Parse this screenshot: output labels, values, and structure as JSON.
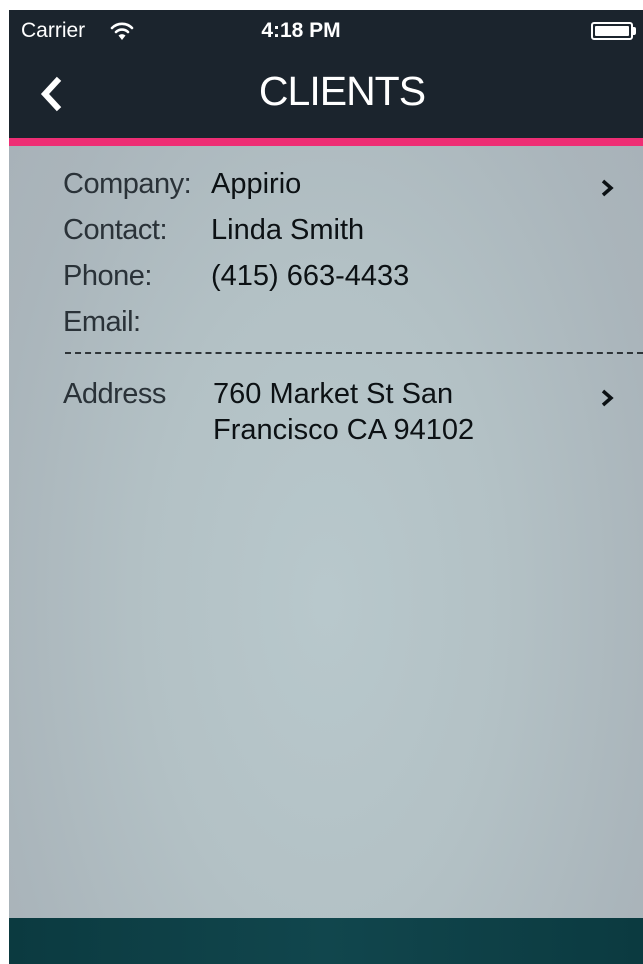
{
  "status_bar": {
    "carrier": "Carrier",
    "time": "4:18 PM",
    "wifi_icon": "wifi-icon",
    "battery_icon": "battery-full-icon"
  },
  "nav": {
    "title": "CLIENTS",
    "back_icon": "chevron-left-icon"
  },
  "colors": {
    "topbar": "#1b242d",
    "accent": "#ee2e74",
    "bottombar": "#0b3a40"
  },
  "fields": {
    "company": {
      "label": "Company:",
      "value": "Appirio"
    },
    "contact": {
      "label": "Contact:",
      "value": "Linda Smith"
    },
    "phone": {
      "label": "Phone:",
      "value": "(415) 663-4433"
    },
    "email": {
      "label": "Email:",
      "value": ""
    },
    "address": {
      "label": "Address",
      "value": "760 Market St San Francisco CA 94102"
    }
  }
}
